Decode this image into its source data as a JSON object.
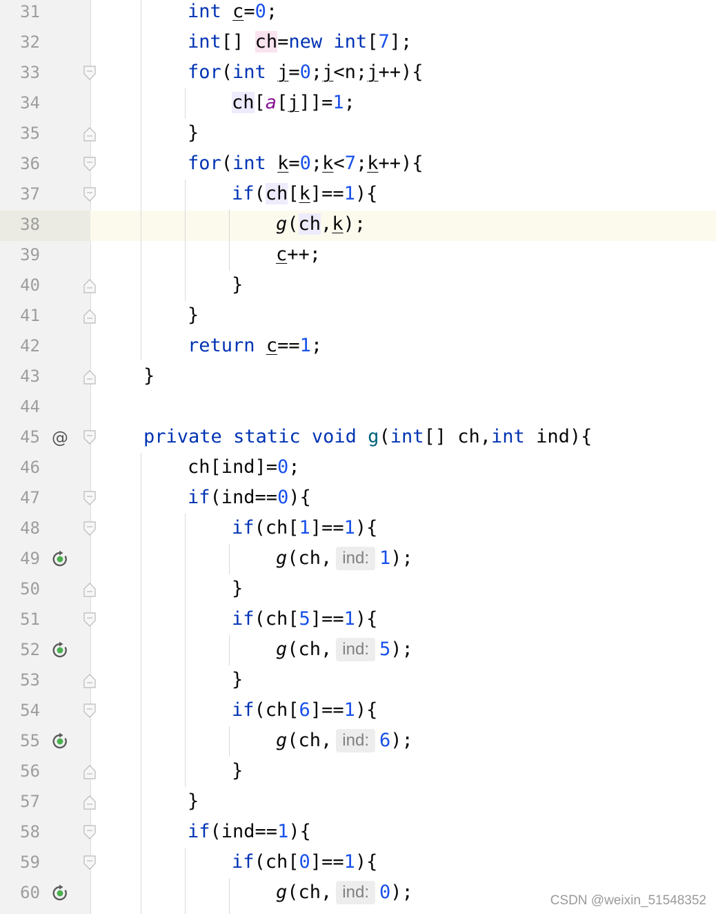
{
  "editor": {
    "current_line": "38",
    "lines": [
      {
        "n": "31",
        "segments": [
          {
            "t": "int",
            "c": "kw"
          },
          {
            "t": " "
          },
          {
            "t": "c",
            "c": "u"
          },
          {
            "t": "="
          },
          {
            "t": "0",
            "c": "num"
          },
          {
            "t": ";"
          }
        ]
      },
      {
        "n": "32",
        "segments": [
          {
            "t": "int",
            "c": "kw"
          },
          {
            "t": "[] "
          },
          {
            "t": "ch",
            "c": "hl-pink"
          },
          {
            "t": "="
          },
          {
            "t": "new",
            "c": "kw"
          },
          {
            "t": " "
          },
          {
            "t": "int",
            "c": "kw"
          },
          {
            "t": "["
          },
          {
            "t": "7",
            "c": "num"
          },
          {
            "t": "];"
          }
        ]
      },
      {
        "n": "33",
        "segments": [
          {
            "t": "for",
            "c": "kw"
          },
          {
            "t": "("
          },
          {
            "t": "int",
            "c": "kw"
          },
          {
            "t": " "
          },
          {
            "t": "j",
            "c": "u"
          },
          {
            "t": "="
          },
          {
            "t": "0",
            "c": "num"
          },
          {
            "t": ";"
          },
          {
            "t": "j",
            "c": "u"
          },
          {
            "t": "<n;"
          },
          {
            "t": "j",
            "c": "u"
          },
          {
            "t": "++){"
          }
        ]
      },
      {
        "n": "34",
        "segments": [
          {
            "t": "ch",
            "c": "hl-lav"
          },
          {
            "t": "["
          },
          {
            "t": "a",
            "c": "par"
          },
          {
            "t": "["
          },
          {
            "t": "j",
            "c": "u"
          },
          {
            "t": "]]="
          },
          {
            "t": "1",
            "c": "num"
          },
          {
            "t": ";"
          }
        ]
      },
      {
        "n": "35",
        "segments": [
          {
            "t": "}"
          }
        ]
      },
      {
        "n": "36",
        "segments": [
          {
            "t": "for",
            "c": "kw"
          },
          {
            "t": "("
          },
          {
            "t": "int",
            "c": "kw"
          },
          {
            "t": " "
          },
          {
            "t": "k",
            "c": "u"
          },
          {
            "t": "="
          },
          {
            "t": "0",
            "c": "num"
          },
          {
            "t": ";"
          },
          {
            "t": "k",
            "c": "u"
          },
          {
            "t": "<"
          },
          {
            "t": "7",
            "c": "num"
          },
          {
            "t": ";"
          },
          {
            "t": "k",
            "c": "u"
          },
          {
            "t": "++){"
          }
        ]
      },
      {
        "n": "37",
        "segments": [
          {
            "t": "if",
            "c": "kw"
          },
          {
            "t": "("
          },
          {
            "t": "ch",
            "c": "hl-lav"
          },
          {
            "t": "["
          },
          {
            "t": "k",
            "c": "u"
          },
          {
            "t": "]=="
          },
          {
            "t": "1",
            "c": "num"
          },
          {
            "t": "){"
          }
        ]
      },
      {
        "n": "38",
        "segments": [
          {
            "t": "g",
            "c": "it"
          },
          {
            "t": "("
          },
          {
            "t": "ch",
            "c": "hl-lav"
          },
          {
            "t": ","
          },
          {
            "t": "k",
            "c": "u"
          },
          {
            "t": ");"
          }
        ]
      },
      {
        "n": "39",
        "segments": [
          {
            "t": "c",
            "c": "u"
          },
          {
            "t": "++;"
          }
        ]
      },
      {
        "n": "40",
        "segments": [
          {
            "t": "}"
          }
        ]
      },
      {
        "n": "41",
        "segments": [
          {
            "t": "}"
          }
        ]
      },
      {
        "n": "42",
        "segments": [
          {
            "t": "return",
            "c": "kw"
          },
          {
            "t": " "
          },
          {
            "t": "c",
            "c": "u"
          },
          {
            "t": "=="
          },
          {
            "t": "1",
            "c": "num"
          },
          {
            "t": ";"
          }
        ]
      },
      {
        "n": "43",
        "segments": [
          {
            "t": "}"
          }
        ]
      },
      {
        "n": "44",
        "segments": []
      },
      {
        "n": "45",
        "segments": [
          {
            "t": "private",
            "c": "kw"
          },
          {
            "t": " "
          },
          {
            "t": "static",
            "c": "kw"
          },
          {
            "t": " "
          },
          {
            "t": "void",
            "c": "kw"
          },
          {
            "t": " "
          },
          {
            "t": "g",
            "c": "fn"
          },
          {
            "t": "("
          },
          {
            "t": "int",
            "c": "kw"
          },
          {
            "t": "[] ch,"
          },
          {
            "t": "int",
            "c": "kw"
          },
          {
            "t": " ind){"
          }
        ]
      },
      {
        "n": "46",
        "segments": [
          {
            "t": "ch[ind]="
          },
          {
            "t": "0",
            "c": "num"
          },
          {
            "t": ";"
          }
        ]
      },
      {
        "n": "47",
        "segments": [
          {
            "t": "if",
            "c": "kw"
          },
          {
            "t": "(ind=="
          },
          {
            "t": "0",
            "c": "num"
          },
          {
            "t": "){"
          }
        ]
      },
      {
        "n": "48",
        "segments": [
          {
            "t": "if",
            "c": "kw"
          },
          {
            "t": "(ch["
          },
          {
            "t": "1",
            "c": "num"
          },
          {
            "t": "]=="
          },
          {
            "t": "1",
            "c": "num"
          },
          {
            "t": "){"
          }
        ]
      },
      {
        "n": "49",
        "segments": [
          {
            "t": "g",
            "c": "it"
          },
          {
            "t": "(ch,"
          },
          {
            "t": "ind:",
            "c": "hint"
          },
          {
            "t": "1",
            "c": "num"
          },
          {
            "t": ");"
          }
        ]
      },
      {
        "n": "50",
        "segments": [
          {
            "t": "}"
          }
        ]
      },
      {
        "n": "51",
        "segments": [
          {
            "t": "if",
            "c": "kw"
          },
          {
            "t": "(ch["
          },
          {
            "t": "5",
            "c": "num"
          },
          {
            "t": "]=="
          },
          {
            "t": "1",
            "c": "num"
          },
          {
            "t": "){"
          }
        ]
      },
      {
        "n": "52",
        "segments": [
          {
            "t": "g",
            "c": "it"
          },
          {
            "t": "(ch,"
          },
          {
            "t": "ind:",
            "c": "hint"
          },
          {
            "t": "5",
            "c": "num"
          },
          {
            "t": ");"
          }
        ]
      },
      {
        "n": "53",
        "segments": [
          {
            "t": "}"
          }
        ]
      },
      {
        "n": "54",
        "segments": [
          {
            "t": "if",
            "c": "kw"
          },
          {
            "t": "(ch["
          },
          {
            "t": "6",
            "c": "num"
          },
          {
            "t": "]=="
          },
          {
            "t": "1",
            "c": "num"
          },
          {
            "t": "){"
          }
        ]
      },
      {
        "n": "55",
        "segments": [
          {
            "t": "g",
            "c": "it"
          },
          {
            "t": "(ch,"
          },
          {
            "t": "ind:",
            "c": "hint"
          },
          {
            "t": "6",
            "c": "num"
          },
          {
            "t": ");"
          }
        ]
      },
      {
        "n": "56",
        "segments": [
          {
            "t": "}"
          }
        ]
      },
      {
        "n": "57",
        "segments": [
          {
            "t": "}"
          }
        ]
      },
      {
        "n": "58",
        "segments": [
          {
            "t": "if",
            "c": "kw"
          },
          {
            "t": "(ind=="
          },
          {
            "t": "1",
            "c": "num"
          },
          {
            "t": "){"
          }
        ]
      },
      {
        "n": "59",
        "segments": [
          {
            "t": "if",
            "c": "kw"
          },
          {
            "t": "(ch["
          },
          {
            "t": "0",
            "c": "num"
          },
          {
            "t": "]=="
          },
          {
            "t": "1",
            "c": "num"
          },
          {
            "t": "){"
          }
        ]
      },
      {
        "n": "60",
        "segments": [
          {
            "t": "g",
            "c": "it"
          },
          {
            "t": "(ch,"
          },
          {
            "t": "ind:",
            "c": "hint"
          },
          {
            "t": "0",
            "c": "num"
          },
          {
            "t": ");"
          }
        ]
      }
    ],
    "gutter_icons": {
      "45": "at-sign-icon",
      "49": "recursive-call-icon",
      "52": "recursive-call-icon",
      "55": "recursive-call-icon",
      "60": "recursive-call-icon"
    },
    "fold_markers": {
      "33": "fold-start-icon",
      "35": "fold-end-icon",
      "36": "fold-start-icon",
      "37": "fold-start-icon",
      "40": "fold-end-icon",
      "41": "fold-end-icon",
      "43": "fold-end-icon",
      "45": "fold-start-icon",
      "47": "fold-start-icon",
      "48": "fold-start-icon",
      "50": "fold-end-icon",
      "51": "fold-start-icon",
      "53": "fold-end-icon",
      "54": "fold-start-icon",
      "56": "fold-end-icon",
      "57": "fold-end-icon",
      "58": "fold-start-icon",
      "59": "fold-start-icon"
    },
    "colors": {
      "keyword": "#0033b3",
      "number": "#1750eb",
      "method": "#00627a",
      "parameter": "#871094",
      "recursion_icon": "#4caf50"
    }
  },
  "watermark": {
    "text": "CSDN @weixin_51548352"
  }
}
